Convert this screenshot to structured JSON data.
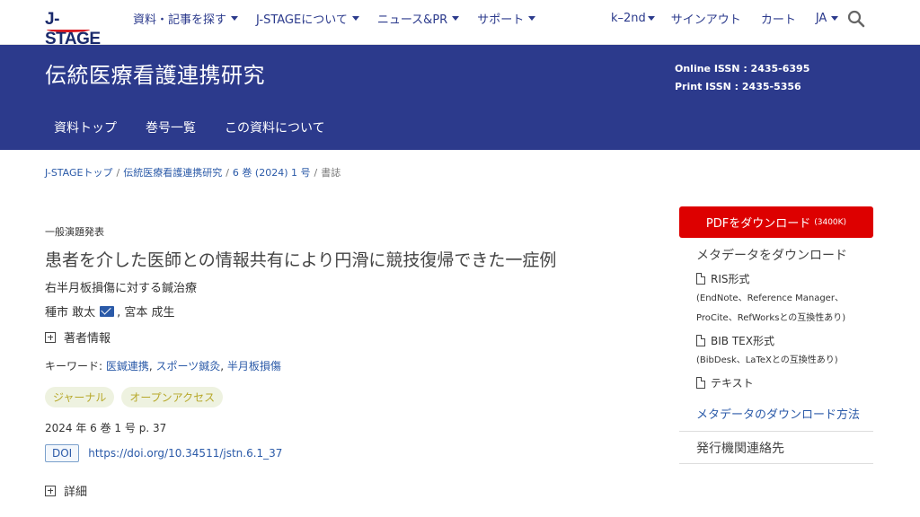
{
  "header": {
    "logo_text": "J-STAGE",
    "nav_left": [
      {
        "label": "資料・記事を探す"
      },
      {
        "label": "J-STAGEについて"
      },
      {
        "label": "ニュース&PR"
      },
      {
        "label": "サポート"
      }
    ],
    "user": "k–2nd",
    "signout": "サインアウト",
    "cart": "カート",
    "language": "JA",
    "search_icon": "search-icon"
  },
  "banner": {
    "journal_title": "伝統医療看護連携研究",
    "online_issn": "Online ISSN : 2435-6395",
    "print_issn": "Print ISSN : 2435-5356",
    "tabs": [
      {
        "label": "資料トップ"
      },
      {
        "label": "巻号一覧"
      },
      {
        "label": "この資料について"
      }
    ],
    "color": "#2c3a8c"
  },
  "breadcrumb": {
    "items": [
      "J-STAGEトップ",
      "伝統医療看護連携研究",
      "6 巻 (2024) 1 号"
    ],
    "current": "書誌",
    "separator": "/"
  },
  "article": {
    "category": "一般演題発表",
    "title": "患者を介した医師との情報共有により円滑に競技復帰できた一症例",
    "subtitle": "右半月板損傷に対する鍼治療",
    "author1": "種市 敢太",
    "author2": ", 宮本 成生",
    "author_info": "著者情報",
    "keywords_label": "キーワード: ",
    "keywords": [
      "医鍼連携",
      "スポーツ鍼灸",
      "半月板損傷"
    ],
    "keyword_sep": ", ",
    "badges": [
      "ジャーナル",
      "オープンアクセス"
    ],
    "volume": "2024 年 6 巻 1 号 p. 37",
    "doi_label": "DOI",
    "doi_url": "https://doi.org/10.34511/jstn.6.1_37",
    "details": "詳細"
  },
  "sidebar": {
    "pdf_label": "PDFをダウンロード",
    "pdf_size": "(3400K)",
    "pdf_color": "#dd0000",
    "meta_heading": "メタデータをダウンロード",
    "ris_label": "RIS形式",
    "ris_note1": "(EndNote、Reference Manager、",
    "ris_note2": "ProCite、RefWorksとの互換性あり)",
    "bib_label": "BIB TEX形式",
    "bib_note": "(BibDesk、LaTeXとの互換性あり)",
    "text_label": "テキスト",
    "howto": "メタデータのダウンロード方法",
    "publisher_contact": "発行機関連絡先"
  }
}
